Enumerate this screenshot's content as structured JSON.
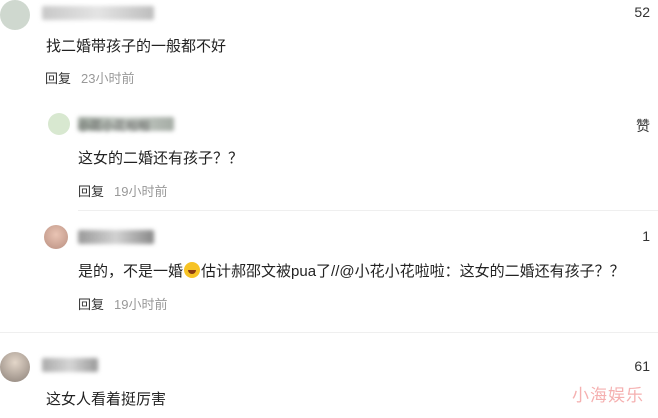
{
  "comments": [
    {
      "likes": "52",
      "text": "找二婚带孩子的一般都不好",
      "reply_label": "回复",
      "time": "23小时前"
    },
    {
      "likes": "赞",
      "name": "小花小花啦啦",
      "text": "这女的二婚还有孩子？？",
      "reply_label": "回复",
      "time": "19小时前"
    },
    {
      "likes": "1",
      "text_before_emoji": "是的，不是一婚",
      "emoji": "rolling-laugh-emoji",
      "text_after_emoji": "估计郝邵文被pua了//@小花小花啦啦：这女的二婚还有孩子？？",
      "reply_label": "回复",
      "time": "19小时前"
    },
    {
      "likes": "61",
      "text": "这女人看着挺厉害"
    }
  ],
  "watermark": "小海娱乐"
}
